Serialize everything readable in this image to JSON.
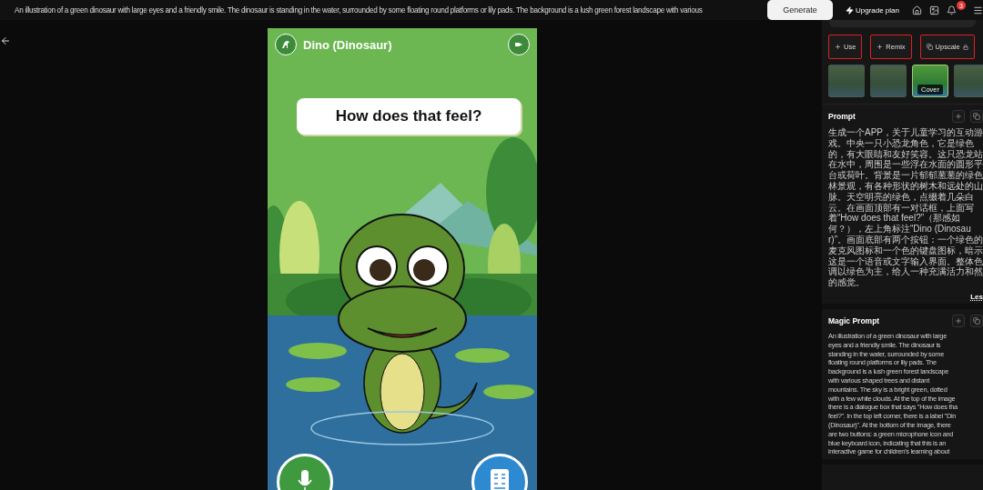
{
  "top_bar": {
    "prompt": "An illustration of a green dinosaur with large eyes and a friendly smile. The dinosaur is standing in the water, surrounded by some floating round platforms or lily pads. The background is a lush green forest landscape with various",
    "generate_button": "Generate",
    "upgrade_button": "Upgrade plan",
    "notification_count": "3"
  },
  "preview": {
    "app_title": "Dino (Dinosaur)",
    "speech_bubble": "How does that feel?"
  },
  "actions": [
    {
      "label": "Use",
      "highlighted": true
    },
    {
      "label": "Remix",
      "highlighted": true
    },
    {
      "label": "Upscale",
      "highlighted": true
    }
  ],
  "thumbnails": [
    {
      "selected": false
    },
    {
      "selected": false
    },
    {
      "selected": true,
      "caption": "Cover"
    },
    {
      "selected": false
    }
  ],
  "prompt": {
    "title": "Prompt",
    "text": "生成一个APP，关于儿童学习的互动游戏。中央一只小恐龙角色，它是绿色的，有大眼睛和友好笑容。这只恐龙站在水中，周围是一些浮在水面的圆形平台或荷叶。背景是一片郁郁葱葱的绿色林景观，有各种形状的树木和远处的山脉。天空明亮的绿色，点缀着几朵白云。在画面顶部有一对话框，上面写着“How does that feel?”（那感如何？），左上角标注“Dino (Dinosaur)”。画面底部有两个按钮：一个绿色的麦克风图标和一个色的键盘图标，暗示这是一个语音或文字输入界面。整体色调以绿色为主，给人一种充满活力和然的感觉。",
    "toggle": "Les"
  },
  "magic_prompt": {
    "title": "Magic Prompt",
    "text": "An illustration of a green dinosaur with large\neyes and a friendly smile. The dinosaur is\nstanding in the water, surrounded by some\nfloating round platforms or lily pads. The\nbackground is a lush green forest landscape\nwith various shaped trees and distant\nmountains. The sky is a bright green, dotted\nwith a few white clouds. At the top of the image\nthere is a dialogue box that says \"How does tha\nfeel?\". In the top left corner, there is a label \"Din\n(Dinosaur)\". At the bottom of the image, there\nare two buttons: a green microphone icon and\nblue keyboard icon, indicating that this is an\ninteractive game for children's learning about"
  }
}
